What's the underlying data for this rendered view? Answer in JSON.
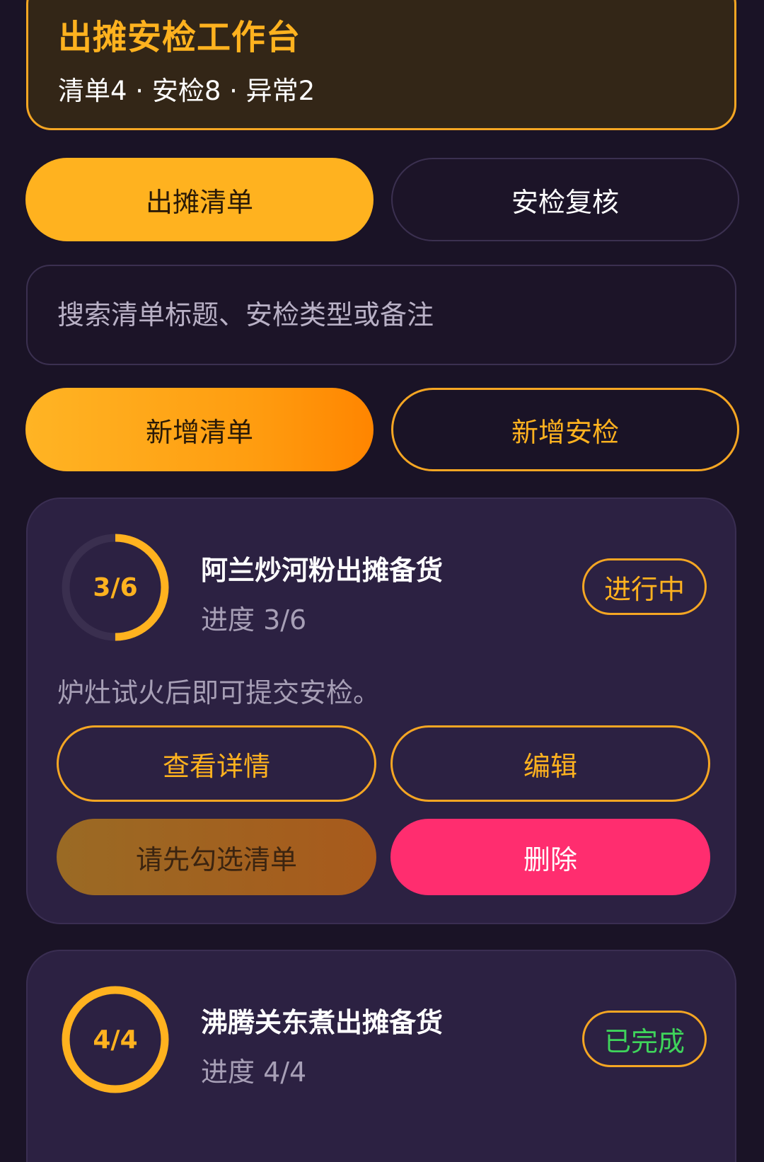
{
  "header": {
    "title": "出摊安检工作台",
    "summary": "清单4 · 安检8 · 异常2"
  },
  "tabs": [
    {
      "label": "出摊清单",
      "active": true
    },
    {
      "label": "安检复核",
      "active": false
    }
  ],
  "search": {
    "placeholder": "搜索清单标题、安检类型或备注",
    "value": ""
  },
  "actions": {
    "add_list": "新增清单",
    "add_check": "新增安检"
  },
  "colors": {
    "accent": "#ffb21f",
    "background": "#1a1326",
    "card": "#2c2142",
    "danger": "#ff2d6f",
    "success": "#3fd45b"
  },
  "cards": [
    {
      "ring_label": "3/6",
      "done": 3,
      "total": 6,
      "title": "阿兰炒河粉出摊备货",
      "progress_text": "进度 3/6",
      "status": "进行中",
      "note": "炉灶试火后即可提交安检。",
      "buttons": {
        "view": "查看详情",
        "edit": "编辑",
        "submit_disabled": "请先勾选清单",
        "delete": "删除"
      }
    },
    {
      "ring_label": "4/4",
      "done": 4,
      "total": 4,
      "title": "沸腾关东煮出摊备货",
      "progress_text": "进度 4/4",
      "status": "已完成"
    }
  ]
}
